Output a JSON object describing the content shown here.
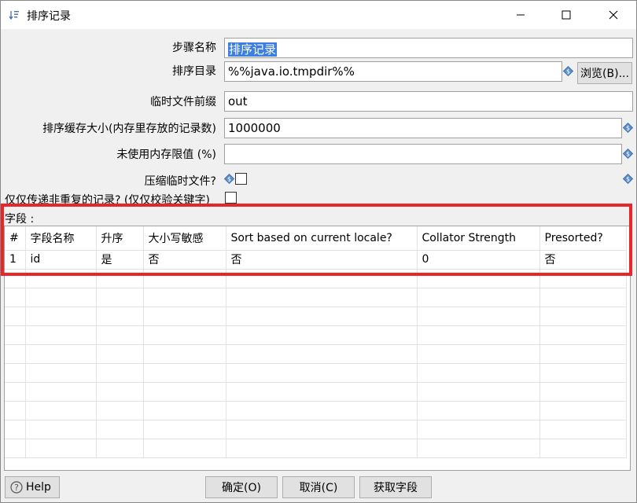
{
  "window": {
    "title": "排序记录"
  },
  "form": {
    "step_name_label": "步骤名称",
    "step_name_value": "排序记录",
    "sort_dir_label": "排序目录",
    "sort_dir_value": "%%java.io.tmpdir%%",
    "browse_button": "浏览(B)...",
    "tmp_prefix_label": "临时文件前缀",
    "tmp_prefix_value": "out",
    "buffer_size_label": "排序缓存大小(内存里存放的记录数)",
    "buffer_size_value": "1000000",
    "free_mem_label": "未使用内存限值 (%)",
    "free_mem_value": "",
    "compress_label": "压缩临时文件?",
    "compress_checked": false,
    "unique_label": "仅仅传递非重复的记录? (仅仅校验关键字)",
    "unique_checked": false
  },
  "fields": {
    "section_label": "字段 :",
    "columns": [
      "#",
      "字段名称",
      "升序",
      "大小写敏感",
      "Sort based on current locale?",
      "Collator Strength",
      "Presorted?"
    ],
    "rows": [
      [
        "1",
        "id",
        "是",
        "否",
        "否",
        "0",
        "否"
      ]
    ]
  },
  "footer": {
    "help": "Help",
    "ok": "确定(O)",
    "cancel": "取消(C)",
    "get_fields": "获取字段"
  }
}
